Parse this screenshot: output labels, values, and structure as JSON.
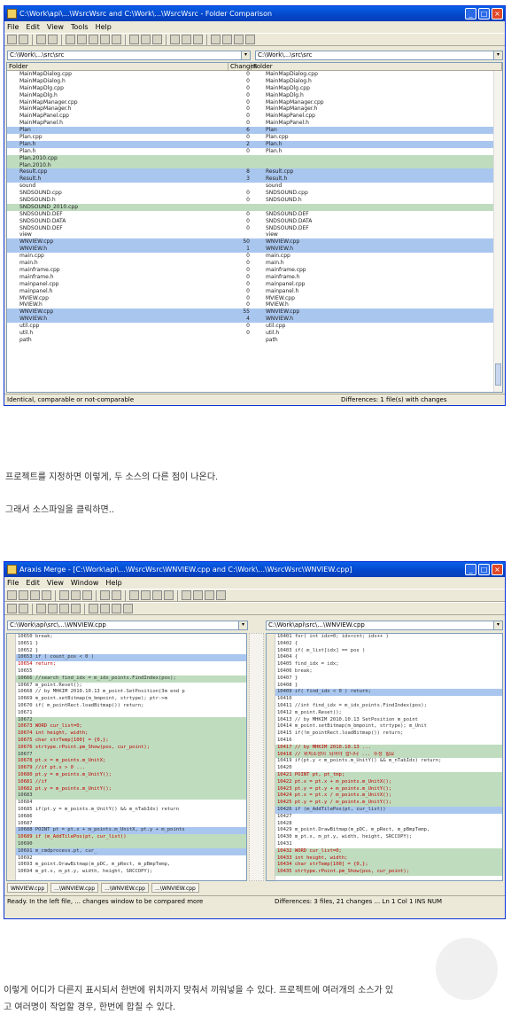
{
  "window1": {
    "title": "C:\\Work\\api\\...\\WsrcWsrc and C:\\Work\\...\\WsrcWsrc - Folder Comparison",
    "menu": [
      "File",
      "Edit",
      "View",
      "Tools",
      "Help"
    ],
    "left_path": "C:\\Work\\...\\src\\src",
    "right_path": "C:\\Work\\...\\src\\src",
    "headers": {
      "folder": "Folder",
      "changes": "Changes",
      "folder_right": "Folder"
    },
    "status_left": "Identical, comparable or not-comparable",
    "status_right": "Differences: 1 file(s) with changes"
  },
  "window2": {
    "title": "Araxis Merge - [C:\\Work\\api\\...\\WsrcWsrc\\WNVIEW.cpp and C:\\Work\\...\\WsrcWsrc\\WNVIEW.cpp]",
    "menu": [
      "File",
      "Edit",
      "View",
      "Window",
      "Help"
    ],
    "left_path": "C:\\Work\\api\\src\\...\\WNVIEW.cpp",
    "right_path": "C:\\Work\\api\\src\\...\\WNVIEW.cpp",
    "tabs": [
      "WNVIEW.cpp",
      "...\\WNVIEW.cpp",
      "...\\WNVIEW.cpp",
      "...\\WNVIEW.cpp"
    ],
    "status_left": "Ready. In the left file, ... changes window to be compared more",
    "status_right": "Differences: 3 files, 21 changes ... Ln 1 Col 1 INS   NUM"
  },
  "caption1": "프로젝트를 지정하면 이렇게, 두 소스의 다른 점이 나온다.",
  "caption2": "그래서 소스파일을 클릭하면..",
  "caption3": "이렇게 어디가 다른지 표시되서 한번에 위치까지 맞춰서 끼워넣을 수 있다. 프로젝트에 여러개의 소스가 있",
  "caption4": "고 여러명이 작업할 경우, 한번에 합칠 수 있다.",
  "tree_rows": [
    {
      "l": "MainMapDialog.cpp",
      "c": "0",
      "r": "MainMapDialog.cpp",
      "s": ""
    },
    {
      "l": "MainMapDialog.h",
      "c": "0",
      "r": "MainMapDialog.h",
      "s": ""
    },
    {
      "l": "MainMapDlg.cpp",
      "c": "0",
      "r": "MainMapDlg.cpp",
      "s": ""
    },
    {
      "l": "MainMapDlg.h",
      "c": "0",
      "r": "MainMapDlg.h",
      "s": ""
    },
    {
      "l": "MainMapManager.cpp",
      "c": "0",
      "r": "MainMapManager.cpp",
      "s": ""
    },
    {
      "l": "MainMapManager.h",
      "c": "0",
      "r": "MainMapManager.h",
      "s": ""
    },
    {
      "l": "MainMapPanel.cpp",
      "c": "0",
      "r": "MainMapPanel.cpp",
      "s": ""
    },
    {
      "l": "MainMapPanel.h",
      "c": "0",
      "r": "MainMapPanel.h",
      "s": ""
    },
    {
      "l": "Plan",
      "c": "6",
      "r": "Plan",
      "s": "blue"
    },
    {
      "l": "Plan.cpp",
      "c": "0",
      "r": "Plan.cpp",
      "s": ""
    },
    {
      "l": "Plan.h",
      "c": "2",
      "r": "Plan.h",
      "s": "blue"
    },
    {
      "l": "Plan.h",
      "c": "0",
      "r": "Plan.h",
      "s": ""
    },
    {
      "l": "Plan.2010.cpp",
      "c": "",
      "r": "",
      "s": "green"
    },
    {
      "l": "Plan.2010.h",
      "c": "",
      "r": "",
      "s": "green"
    },
    {
      "l": "Result.cpp",
      "c": "8",
      "r": "Result.cpp",
      "s": "blue"
    },
    {
      "l": "Result.h",
      "c": "3",
      "r": "Result.h",
      "s": "blue"
    },
    {
      "l": "sound",
      "c": "",
      "r": "sound",
      "s": ""
    },
    {
      "l": "SNDSOUND.cpp",
      "c": "0",
      "r": "SNDSOUND.cpp",
      "s": ""
    },
    {
      "l": "SNDSOUND.h",
      "c": "0",
      "r": "SNDSOUND.h",
      "s": ""
    },
    {
      "l": "SNDSOUND_2010.cpp",
      "c": "",
      "r": "",
      "s": "green"
    },
    {
      "l": "SNDSOUND.DEF",
      "c": "0",
      "r": "SNDSOUND.DEF",
      "s": ""
    },
    {
      "l": "SNDSOUND.DATA",
      "c": "0",
      "r": "SNDSOUND.DATA",
      "s": ""
    },
    {
      "l": "SNDSOUND.DEF",
      "c": "0",
      "r": "SNDSOUND.DEF",
      "s": ""
    },
    {
      "l": "view",
      "c": "",
      "r": "view",
      "s": ""
    },
    {
      "l": "WNVIEW.cpp",
      "c": "50",
      "r": "WNVIEW.cpp",
      "s": "blue"
    },
    {
      "l": "WNVIEW.h",
      "c": "1",
      "r": "WNVIEW.h",
      "s": "blue"
    },
    {
      "l": "main.cpp",
      "c": "0",
      "r": "main.cpp",
      "s": ""
    },
    {
      "l": "main.h",
      "c": "0",
      "r": "main.h",
      "s": ""
    },
    {
      "l": "mainframe.cpp",
      "c": "0",
      "r": "mainframe.cpp",
      "s": ""
    },
    {
      "l": "mainframe.h",
      "c": "0",
      "r": "mainframe.h",
      "s": ""
    },
    {
      "l": "mainpanel.cpp",
      "c": "0",
      "r": "mainpanel.cpp",
      "s": ""
    },
    {
      "l": "mainpanel.h",
      "c": "0",
      "r": "mainpanel.h",
      "s": ""
    },
    {
      "l": "MVIEW.cpp",
      "c": "0",
      "r": "MVIEW.cpp",
      "s": ""
    },
    {
      "l": "MVIEW.h",
      "c": "0",
      "r": "MVIEW.h",
      "s": ""
    },
    {
      "l": "WNVIEW.cpp",
      "c": "55",
      "r": "WNVIEW.cpp",
      "s": "blue"
    },
    {
      "l": "WNVIEW.h",
      "c": "4",
      "r": "WNVIEW.h",
      "s": "blue"
    },
    {
      "l": "util.cpp",
      "c": "0",
      "r": "util.cpp",
      "s": ""
    },
    {
      "l": "util.h",
      "c": "0",
      "r": "util.h",
      "s": ""
    },
    {
      "l": "path",
      "c": "",
      "r": "path",
      "s": ""
    }
  ],
  "code_left": [
    {
      "t": "  10650                       break;",
      "s": ""
    },
    {
      "t": "  10651             }",
      "s": ""
    },
    {
      "t": "  10652       }",
      "s": ""
    },
    {
      "t": "  10653       if ( count_pos < 0 )",
      "s": "blue"
    },
    {
      "t": "  10654             return;",
      "s": "red"
    },
    {
      "t": "  10655",
      "s": ""
    },
    {
      "t": "  10666       //search find_idx = m_idx_points.FindIndex(pos);",
      "s": "green"
    },
    {
      "t": "  10667       m_point.Reset();",
      "s": ""
    },
    {
      "t": "  10668       // by MHKIM 2010.10.13 m_point.SetPosition(3m end p",
      "s": ""
    },
    {
      "t": "  10669       m_point.setBitmap(m_bmpoint, strtype); ptr->m",
      "s": ""
    },
    {
      "t": "  10670       if( m_pointRect.loadBitmap()) return;",
      "s": ""
    },
    {
      "t": "  10671",
      "s": ""
    },
    {
      "t": "  10672",
      "s": "green"
    },
    {
      "t": "  10673       WORD cur_list=0;",
      "s": "green red"
    },
    {
      "t": "  10674       int height, width;",
      "s": "green red"
    },
    {
      "t": "  10675       char strTemp[100] = {0,};",
      "s": "green red"
    },
    {
      "t": "  10676       strtype.rPoint.pm_Show(pos, cur_point);",
      "s": "green red"
    },
    {
      "t": "  10677",
      "s": "green"
    },
    {
      "t": "  10678       pt.x = m_points.m_UnitX;",
      "s": "green red"
    },
    {
      "t": "  10679       //if pt.x > 0 ...",
      "s": "green red"
    },
    {
      "t": "  10680             pt.y = m_points.m_UnitY();",
      "s": "green red"
    },
    {
      "t": "  10681       //if",
      "s": "green red"
    },
    {
      "t": "  10682             pt.y = m_points.m_UnitY();",
      "s": "green red"
    },
    {
      "t": "  10683",
      "s": "green"
    },
    {
      "t": "  10684",
      "s": ""
    },
    {
      "t": "  10685       if(pt.y = m_points.m_UnitY() && m_nTabIdx) return",
      "s": ""
    },
    {
      "t": "  10686",
      "s": ""
    },
    {
      "t": "  10687",
      "s": ""
    },
    {
      "t": "  10688       POINT pt = pt.x + m_points.m_UnitX, pt.y + m_points",
      "s": "blue"
    },
    {
      "t": "  10689       if (m_AddTilePos(pt, cur_list))",
      "s": "green red"
    },
    {
      "t": "  10690",
      "s": "green"
    },
    {
      "t": "  10691       m_cmdprocess.pt, cur_",
      "s": "blue"
    },
    {
      "t": "  10692",
      "s": ""
    },
    {
      "t": "  10693       m_point.DrawBitmap(m_pDC, m_pRect, m_pBmpTemp,",
      "s": ""
    },
    {
      "t": "  10694             m_pt.x, m_pt.y, width, height, SRCCOPY);",
      "s": ""
    }
  ],
  "code_right": [
    {
      "t": "  10401       for( int idx=0; idx<cnt; idx++ )",
      "s": ""
    },
    {
      "t": "  10402       {",
      "s": ""
    },
    {
      "t": "  10403             if( m_list[idx] == pos )",
      "s": ""
    },
    {
      "t": "  10404             {",
      "s": ""
    },
    {
      "t": "  10405                   find_idx = idx;",
      "s": ""
    },
    {
      "t": "  10406                   break;",
      "s": ""
    },
    {
      "t": "  10407             }",
      "s": ""
    },
    {
      "t": "  10408       }",
      "s": ""
    },
    {
      "t": "  10409       if( find_idx < 0 ) return;",
      "s": "blue"
    },
    {
      "t": "  10410",
      "s": ""
    },
    {
      "t": "  10411       //int find_idx = m_idx_points.FindIndex(pos);",
      "s": ""
    },
    {
      "t": "  10412       m_point.Reset();",
      "s": ""
    },
    {
      "t": "  10413       // by MHKIM 2010.10.13 SetPosition  m_point",
      "s": ""
    },
    {
      "t": "  10414       m_point.setBitmap(m_bmpoint, strtype);  m_Unit",
      "s": ""
    },
    {
      "t": "  10415       if(!m_pointRect.loadBitmap()) return;",
      "s": ""
    },
    {
      "t": "  10416",
      "s": ""
    },
    {
      "t": "  10417       // by MHKIM 2010.10.13 ...",
      "s": "green red"
    },
    {
      "t": "  10418       // 위치조정이 되어야 합니다 ... 수정 필요",
      "s": "green red"
    },
    {
      "t": "  10419       if(pt.y < m_points.m_UnitY() && m_nTabIdx) return;",
      "s": ""
    },
    {
      "t": "  10420",
      "s": ""
    },
    {
      "t": "  10421       POINT pt, pt_tmp;",
      "s": "green red"
    },
    {
      "t": "  10422       pt.x = pt.x + m_points.m_UnitX();",
      "s": "green red"
    },
    {
      "t": "  10423       pt.y = pt.y + m_points.m_UnitY();",
      "s": "green red"
    },
    {
      "t": "  10424       pt.x = pt.x / m_points.m_UnitX();",
      "s": "green red"
    },
    {
      "t": "  10425       pt.y = pt.y / m_points.m_UnitY();",
      "s": "green red"
    },
    {
      "t": "  10426       if (m_AddTilePos(pt, cur_list))",
      "s": "blue"
    },
    {
      "t": "  10427",
      "s": ""
    },
    {
      "t": "  10428",
      "s": ""
    },
    {
      "t": "  10429       m_point.DrawBitmap(m_pDC, m_pRect, m_pBmpTemp,",
      "s": ""
    },
    {
      "t": "  10430             m_pt.x, m_pt.y, width, height, SRCCOPY);",
      "s": ""
    },
    {
      "t": "  10431",
      "s": ""
    },
    {
      "t": "  10432       WORD cur_list=0;",
      "s": "green red"
    },
    {
      "t": "  10433       int height, width;",
      "s": "green red"
    },
    {
      "t": "  10434       char strTemp[100] = {0,};",
      "s": "green red"
    },
    {
      "t": "  10435       strtype.rPoint.pm_Show(pos, cur_point);",
      "s": "green red"
    }
  ]
}
